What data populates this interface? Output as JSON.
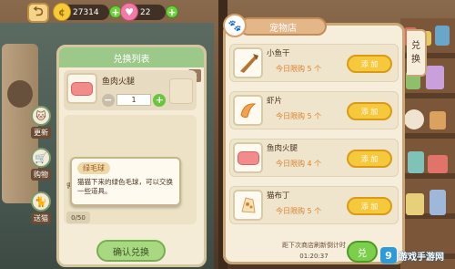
{
  "hud": {
    "back_icon": "back-arrow-icon",
    "coin_amount": "27314",
    "gem_amount": "22",
    "coin_icon": "coin-icon",
    "gem_icon": "heart-gem-icon",
    "plus_label": "+"
  },
  "side_buttons": [
    {
      "label": "更新",
      "icon": "cat-face-icon"
    },
    {
      "label": "购物",
      "icon": "cart-icon"
    },
    {
      "label": "送猫",
      "icon": "cat-icon"
    }
  ],
  "exchange_panel": {
    "title": "兑换列表",
    "close_label": "x",
    "item": {
      "name": "鱼肉火腿",
      "quantity": "1",
      "minus_label": "−",
      "plus_label": "+"
    },
    "side_text_top": "需要",
    "counter": "0/50",
    "confirm_label": "确认兑换"
  },
  "tooltip": {
    "title": "绿毛球",
    "description": "猫猫下来的绿色毛球，可以交换一些道具。"
  },
  "shop": {
    "title": "宠物店",
    "bowl_icon": "cat-bowl-icon",
    "items": [
      {
        "name": "小鱼干",
        "limit": "今日限购 5 个",
        "button": "添 加",
        "icon": "dried-fish-icon"
      },
      {
        "name": "虾片",
        "limit": "今日限购 5 个",
        "button": "添 加",
        "icon": "shrimp-chip-icon"
      },
      {
        "name": "鱼肉火腿",
        "limit": "今日限购 4 个",
        "button": "添 加",
        "icon": "fish-ham-icon"
      },
      {
        "name": "猫布丁",
        "limit": "今日限购 5 个",
        "button": "添 加",
        "icon": "cat-pudding-icon"
      }
    ],
    "refresh_text": "距下次商店刷新倒计时",
    "timer": "01:20:37",
    "exchange_label": "兑"
  },
  "right_tab": {
    "line1": "兑",
    "line2": "换"
  },
  "watermark": {
    "logo": "9",
    "text": "游戏手游网"
  }
}
